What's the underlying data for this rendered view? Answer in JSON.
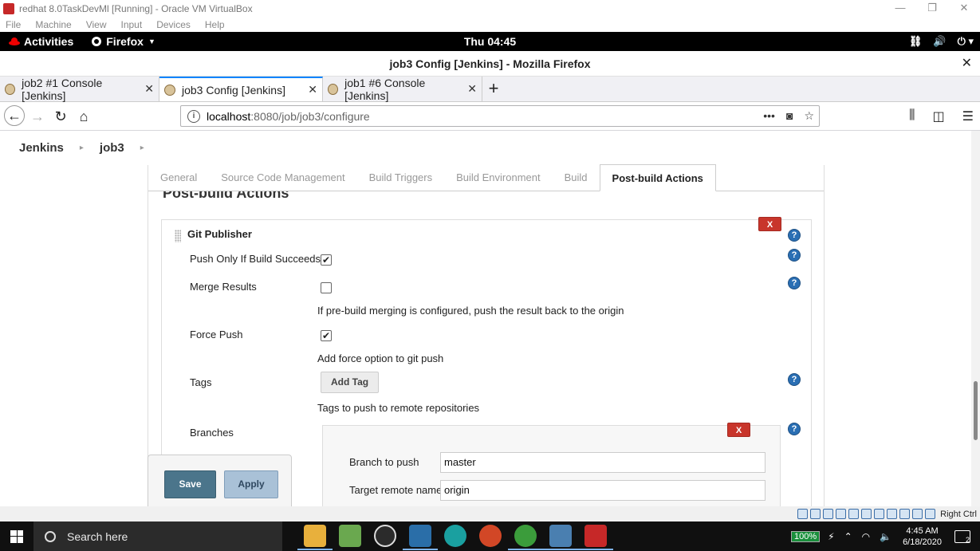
{
  "vbox": {
    "title": "redhat 8.0TaskDevMl [Running] - Oracle VM VirtualBox",
    "menu": [
      "File",
      "Machine",
      "View",
      "Input",
      "Devices",
      "Help"
    ],
    "status_host_key": "Right Ctrl"
  },
  "gnome": {
    "activities": "Activities",
    "app_menu": "Firefox",
    "clock": "Thu 04:45"
  },
  "firefox": {
    "window_title": "job3 Config [Jenkins] - Mozilla Firefox",
    "tabs": [
      {
        "label": "job2 #1 Console [Jenkins]",
        "active": false
      },
      {
        "label": "job3 Config [Jenkins]",
        "active": true
      },
      {
        "label": "job1 #6 Console [Jenkins]",
        "active": false
      }
    ],
    "url_host": "localhost",
    "url_path": ":8080/job/job3/configure"
  },
  "jenkins": {
    "breadcrumb": [
      "Jenkins",
      "job3"
    ],
    "config_tabs": [
      "General",
      "Source Code Management",
      "Build Triggers",
      "Build Environment",
      "Build",
      "Post-build Actions"
    ],
    "active_tab": "Post-build Actions",
    "section_title": "Post-build Actions",
    "publisher": {
      "title": "Git Publisher",
      "delete_label": "X",
      "push_only_label": "Push Only If Build Succeeds",
      "push_only_checked": true,
      "merge_label": "Merge Results",
      "merge_checked": false,
      "merge_desc": "If pre-build merging is configured, push the result back to the origin",
      "force_label": "Force Push",
      "force_checked": true,
      "force_desc": "Add force option to git push",
      "tags_label": "Tags",
      "add_tag_label": "Add Tag",
      "tags_desc": "Tags to push to remote repositories",
      "branches_label": "Branches",
      "branch": {
        "branch_label": "Branch to push",
        "branch_value": "master",
        "remote_label": "Target remote name",
        "remote_value": "origin"
      }
    },
    "save_label": "Save",
    "apply_label": "Apply"
  },
  "taskbar": {
    "search_placeholder": "Search here",
    "battery": "100%",
    "time": "4:45 AM",
    "date": "6/18/2020",
    "notifications": "2"
  }
}
